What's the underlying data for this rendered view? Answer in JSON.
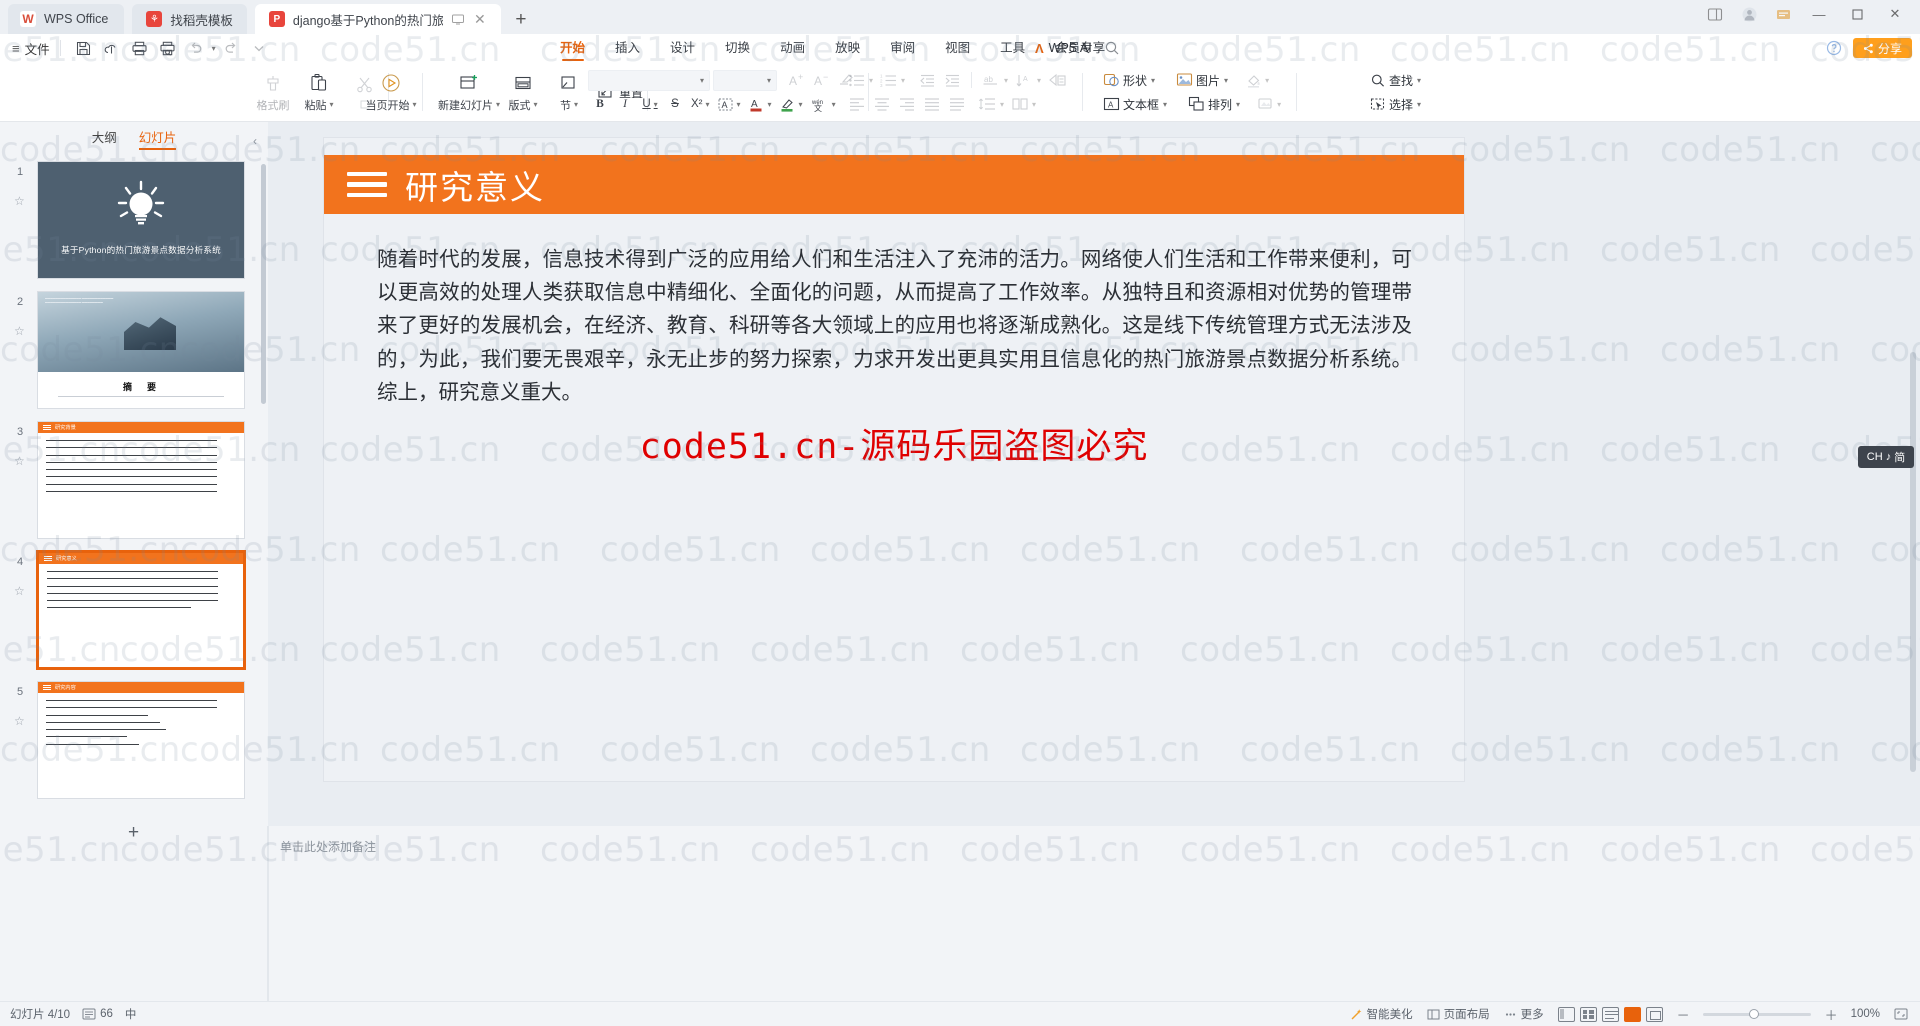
{
  "tabbar": {
    "home_tab": "WPS Office",
    "tabs": [
      {
        "label": "找稻壳模板",
        "icon": "docer-icon"
      },
      {
        "label": "django基于Python的热门旅",
        "icon": "ppt-file-icon"
      }
    ],
    "new_tab": "+",
    "window_controls": {
      "minimize": "—",
      "maximize": "▫",
      "close": "✕"
    }
  },
  "menubar": {
    "hamburger": "≡",
    "file": "文件",
    "quick_access": [
      "save-icon",
      "save-as-cloud-icon",
      "print-icon",
      "print-preview-icon",
      "undo-icon",
      "redo-icon",
      "customize-icon"
    ],
    "ribbon_tabs": [
      "开始",
      "插入",
      "设计",
      "切换",
      "动画",
      "放映",
      "审阅",
      "视图",
      "工具",
      "会员专享"
    ],
    "selected_ribbon_tab": "开始",
    "wps_ai": "WPS AI",
    "search": "search-icon",
    "share": "分享",
    "help": "help-icon"
  },
  "ribbon": {
    "format_painter": "格式刷",
    "paste": "粘贴",
    "cut": "剪切",
    "start_from_page": "当页开始",
    "new_slide": "新建幻灯片",
    "layout": "版式",
    "section": "节",
    "reset": "重置",
    "font_name": "",
    "font_size": "",
    "increase_font": "A+",
    "decrease_font": "A-",
    "clear_format": "clear-format-icon",
    "bold": "B",
    "italic": "I",
    "underline": "U",
    "strikethrough": "S",
    "superscript": "X²",
    "char_border": "A-border-icon",
    "text_highlight": "highlight-icon",
    "font_color": "font-color-icon",
    "pinyin": "pinyin-icon",
    "bullets": "bullets-icon",
    "numbering": "numbering-icon",
    "align_left": "align-left-icon",
    "align_center": "align-center-icon",
    "align_right": "align-right-icon",
    "align_justify": "align-justify-icon",
    "align_distributed": "align-distributed-icon",
    "line_spacing": "line-spacing-icon",
    "columns": "columns-icon",
    "indent_decrease": "indent-decrease-icon",
    "indent_increase": "indent-increase-icon",
    "text_direction": "text-direction-icon",
    "sort": "sort-icon",
    "convert_smartart": "smartart-icon",
    "shape": "形状",
    "picture": "图片",
    "fill": "fill-icon",
    "textbox": "文本框",
    "arrange": "排列",
    "quick_style": "quick-style-icon",
    "find": "查找",
    "select": "选择"
  },
  "left_panel": {
    "tabs": [
      "大纲",
      "幻灯片"
    ],
    "selected_tab": "幻灯片",
    "collapse": "‹",
    "slides": [
      {
        "num": "1",
        "title": "基于Python的热门旅游景点数据分析系统",
        "type": "cover"
      },
      {
        "num": "2",
        "title": "摘　要",
        "type": "image-abstract"
      },
      {
        "num": "3",
        "title": "研究背景",
        "type": "content"
      },
      {
        "num": "4",
        "title": "研究意义",
        "type": "content",
        "selected": true
      },
      {
        "num": "5",
        "title": "研究内容",
        "type": "content"
      }
    ],
    "add_slide": "+"
  },
  "slide": {
    "title": "研究意义",
    "body": "随着时代的发展，信息技术得到广泛的应用给人们和生活注入了充沛的活力。网络使人们生活和工作带来便利，可以更高效的处理人类获取信息中精细化、全面化的问题，从而提高了工作效率。从独特且和资源相对优势的管理带来了更好的发展机会，在经济、教育、科研等各大领域上的应用也将逐渐成熟化。这是线下传统管理方式无法涉及的，为此，我们要无畏艰辛，永无止步的努力探索，力求开发出更具实用且信息化的热门旅游景点数据分析系统。综上，研究意义重大。",
    "watermark": "code51.cn-源码乐园盗图必究"
  },
  "slide_thumbs": {
    "s3_header": "研究背景",
    "s4_header": "研究意义",
    "s5_header": "研究内容",
    "s2_label": "摘　要",
    "s1_title": "基于Python的热门旅游景点数据分析系统"
  },
  "notes": {
    "placeholder": "单击此处添加备注"
  },
  "statusbar": {
    "slide_indicator": "幻灯片 4/10",
    "word_count": "66",
    "language": "中",
    "spellcheck": "智能美化",
    "toolbar_items": [
      "智能美化",
      "页面布局",
      "更多"
    ],
    "zoom_percent": "100%",
    "zoom_minus": "－",
    "zoom_plus": "＋",
    "fit_icon": "fit-screen-icon"
  },
  "ime": {
    "label": "CH",
    "mode": "简",
    "glyph": "♪"
  },
  "watermark": {
    "text": "code51.cn"
  },
  "colors": {
    "accent_orange": "#f2731d",
    "tab_active_orange": "#e8620c",
    "share_orange": "#ff9f1c",
    "slide_bg": "#eef1f5",
    "canvas_bg": "#e9edf2",
    "chrome_bg": "#f2f4f7",
    "red_watermark": "#e00000"
  }
}
